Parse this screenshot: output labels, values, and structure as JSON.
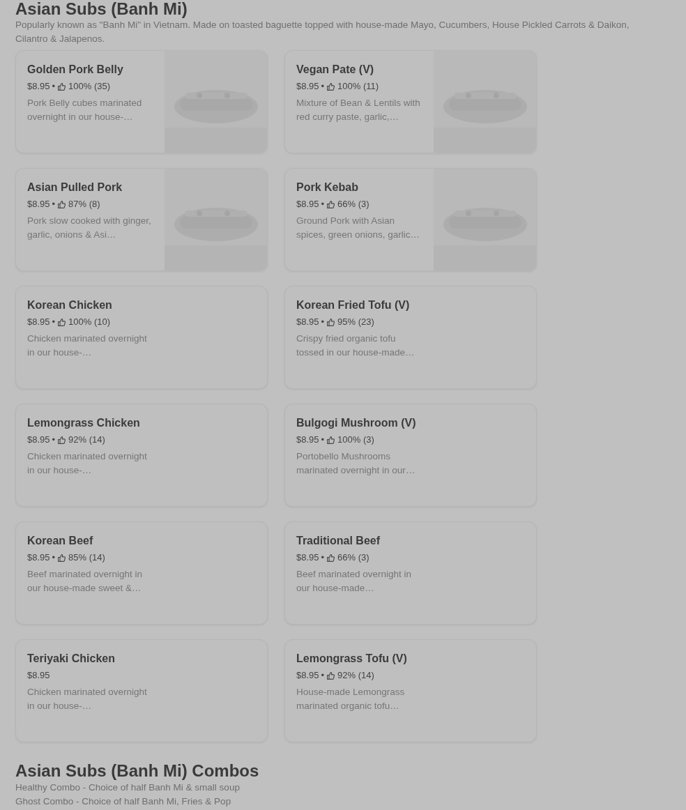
{
  "section": {
    "title": "Asian Subs (Banh Mi)",
    "description": "Popularly known as \"Banh Mi\" in Vietnam. Made on toasted baguette topped with house-made Mayo, Cucumbers, House Pickled Carrots & Daikon, Cilantro & Jalapenos."
  },
  "items": [
    {
      "name": "Golden Pork Belly",
      "price": "$8.95",
      "rating": "100% (35)",
      "separator": "•",
      "description": "Pork Belly cubes marinated overnight in our house-…",
      "image": true
    },
    {
      "name": "Vegan Pate (V)",
      "price": "$8.95",
      "rating": "100% (11)",
      "separator": "•",
      "description": "Mixture of Bean & Lentils with red curry paste, garlic,…",
      "image": true
    },
    {
      "name": "Asian Pulled Pork",
      "price": "$8.95",
      "rating": "87% (8)",
      "separator": "•",
      "description": "Pork slow cooked with ginger, garlic, onions & Asi…",
      "image": true
    },
    {
      "name": "Pork Kebab",
      "price": "$8.95",
      "rating": "66% (3)",
      "separator": "•",
      "description": "Ground Pork with Asian spices, green onions, garlic…",
      "image": true
    },
    {
      "name": "Korean Chicken",
      "price": "$8.95",
      "rating": "100% (10)",
      "separator": "•",
      "description": "Chicken marinated overnight in our house-…",
      "image": false
    },
    {
      "name": "Korean Fried Tofu (V)",
      "price": "$8.95",
      "rating": "95% (23)",
      "separator": "•",
      "description": "Crispy fried organic tofu tossed in our house-made…",
      "image": false
    },
    {
      "name": "Lemongrass Chicken",
      "price": "$8.95",
      "rating": "92% (14)",
      "separator": "•",
      "description": "Chicken marinated overnight in our house-…",
      "image": false
    },
    {
      "name": "Bulgogi Mushroom (V)",
      "price": "$8.95",
      "rating": "100% (3)",
      "separator": "•",
      "description": "Portobello Mushrooms marinated overnight in our…",
      "image": false
    },
    {
      "name": "Korean Beef",
      "price": "$8.95",
      "rating": "85% (14)",
      "separator": "•",
      "description": "Beef marinated overnight in our house-made sweet &…",
      "image": false
    },
    {
      "name": "Traditional Beef",
      "price": "$8.95",
      "rating": "66% (3)",
      "separator": "•",
      "description": "Beef marinated overnight in our house-made…",
      "image": false
    },
    {
      "name": "Teriyaki Chicken",
      "price": "$8.95",
      "description": "Chicken marinated overnight in our house-…",
      "image": false
    },
    {
      "name": "Lemongrass Tofu (V)",
      "price": "$8.95",
      "rating": "92% (14)",
      "separator": "•",
      "description": "House-made Lemongrass marinated organic tofu…",
      "image": false
    }
  ],
  "next_section": {
    "title": "Asian Subs (Banh Mi) Combos",
    "lines": [
      "Healthy Combo - Choice of half Banh Mi & small soup",
      "Ghost Combo - Choice of half Banh Mi, Fries & Pop"
    ]
  }
}
